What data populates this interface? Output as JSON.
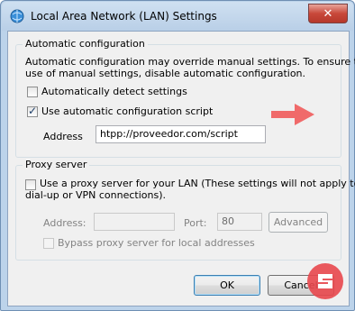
{
  "window": {
    "title": "Local Area Network (LAN) Settings",
    "close_glyph": "✕"
  },
  "auto_config": {
    "legend": "Automatic configuration",
    "description_line1": "Automatic configuration may override manual settings.  To ensure the",
    "description_line2": "use of manual settings, disable automatic configuration.",
    "detect_label": "Automatically detect settings",
    "detect_checked": false,
    "script_label": "Use automatic configuration script",
    "script_checked": true,
    "address_label": "Address",
    "address_value": "htpp://proveedor.com/script"
  },
  "proxy": {
    "legend": "Proxy server",
    "use_proxy_line1": "Use a proxy server for your LAN (These settings will not apply to",
    "use_proxy_line2": "dial-up or VPN connections).",
    "use_proxy_checked": false,
    "address_label": "Address:",
    "address_value": "",
    "port_label": "Port:",
    "port_value": "80",
    "advanced_label": "Advanced",
    "bypass_label": "Bypass proxy server for local addresses",
    "bypass_checked": false
  },
  "buttons": {
    "ok_label": "OK",
    "cancel_label": "Cancel"
  },
  "colors": {
    "arrow": "#f06a6a",
    "logo": "#e8474c"
  }
}
